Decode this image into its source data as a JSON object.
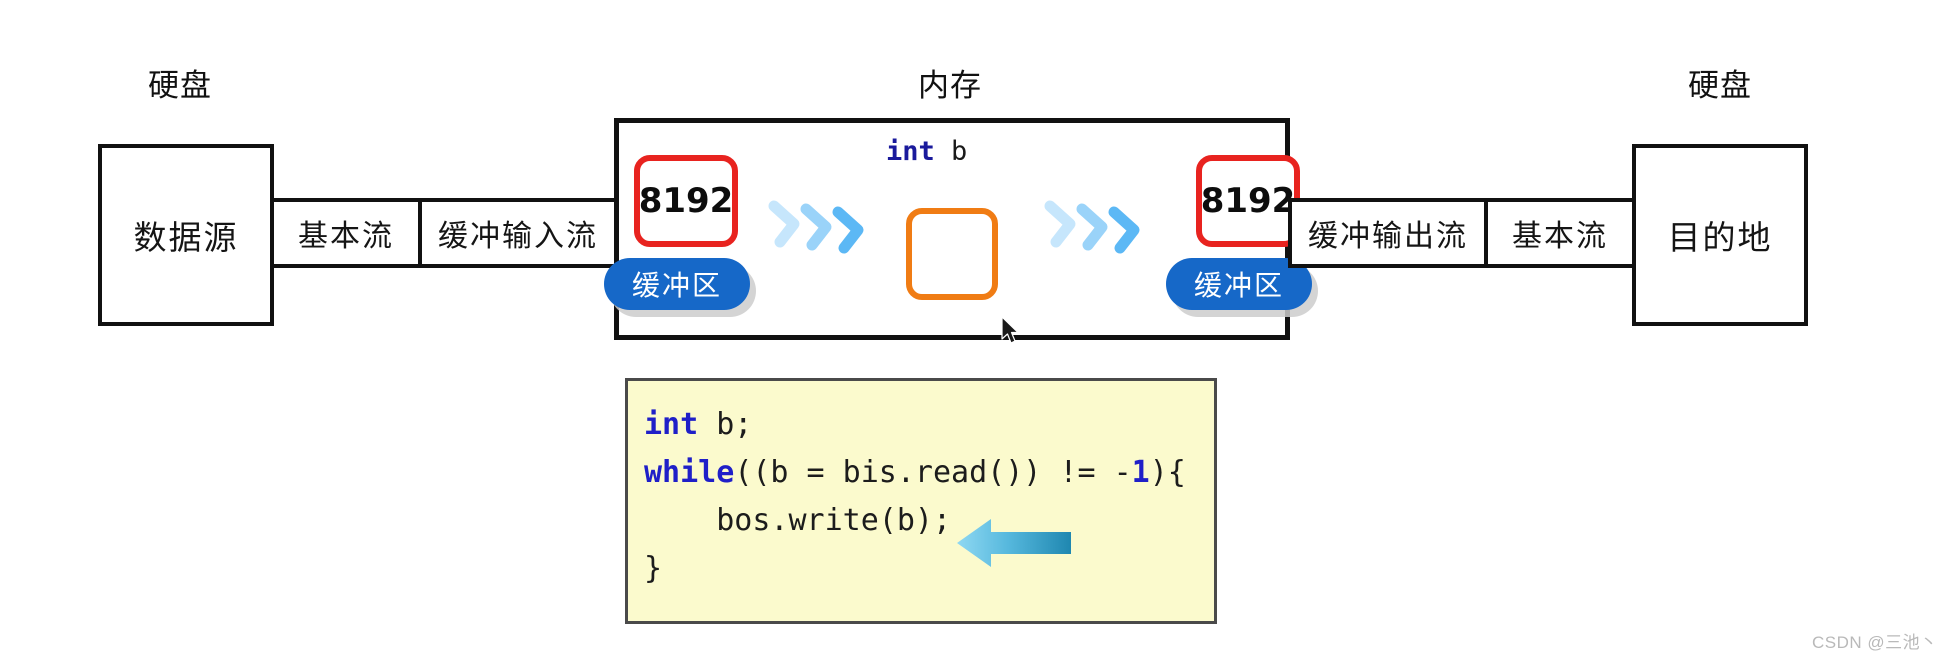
{
  "captions": {
    "left_disk": "硬盘",
    "memory": "内存",
    "right_disk": "硬盘"
  },
  "left_chain": {
    "source_box": "数据源",
    "segments": [
      "基本流",
      "缓冲输入流"
    ]
  },
  "right_chain": {
    "segments": [
      "缓冲输出流",
      "基本流"
    ],
    "destination_box": "目的地"
  },
  "memory": {
    "input_buffer": {
      "size": "8192",
      "pill_label": "缓冲区"
    },
    "output_buffer": {
      "size": "8192",
      "pill_label": "缓冲区"
    },
    "variable": {
      "type": "int",
      "name": "b"
    }
  },
  "code": {
    "lines": [
      {
        "parts": [
          {
            "t": "int",
            "c": "kw"
          },
          {
            "t": " b;",
            "c": ""
          }
        ]
      },
      {
        "parts": [
          {
            "t": "while",
            "c": "kw"
          },
          {
            "t": "((b = bis.read()) != -",
            "c": ""
          },
          {
            "t": "1",
            "c": "num"
          },
          {
            "t": "){",
            "c": ""
          }
        ]
      },
      {
        "parts": [
          {
            "t": "    bos.write(b);",
            "c": ""
          }
        ]
      },
      {
        "parts": [
          {
            "t": "}",
            "c": ""
          }
        ]
      }
    ]
  },
  "watermark": "CSDN @三池丶",
  "colors": {
    "buffer_chip_border": "#e8231f",
    "buffer_pill": "#1668c8",
    "variable_box_border": "#f07c14",
    "flow_arrow": "#5cb8f5",
    "code_background": "#fbfacd",
    "code_keyword": "#1f1fc8",
    "highlight_arrow_light": "#7ed2ef",
    "highlight_arrow_dark": "#1f87b0"
  }
}
